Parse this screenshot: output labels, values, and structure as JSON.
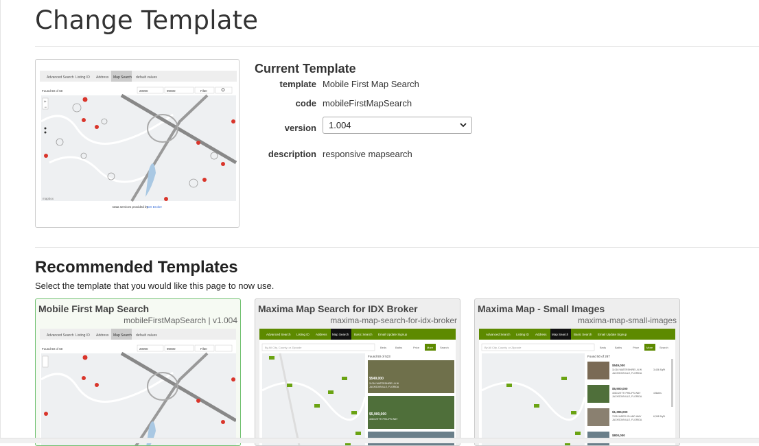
{
  "page": {
    "title": "Change Template"
  },
  "current": {
    "heading": "Current Template",
    "labels": {
      "template": "template",
      "code": "code",
      "version": "version",
      "description": "description"
    },
    "template": "Mobile First Map Search",
    "code": "mobileFirstMapSearch",
    "version": "1.004",
    "description": "responsive mapsearch",
    "thumb": {
      "tabs": [
        "Advanced Search",
        "Listing ID",
        "Address",
        "Map Search",
        "default values"
      ],
      "found": "Found 60 of 60",
      "min": "20000",
      "max": "90000",
      "filter": "Filter",
      "footer_prefix": "Data services provided by ",
      "footer_link": "IDX Broker"
    }
  },
  "recommended": {
    "heading": "Recommended Templates",
    "subtitle": "Select the template that you would like this page to now use.",
    "cards": [
      {
        "name": "Mobile First Map Search",
        "code": "mobileFirstMapSearch | v1.004",
        "selected": true
      },
      {
        "name": "Maxima Map Search for IDX Broker",
        "code": "maxima-map-search-for-idx-broker",
        "selected": false
      },
      {
        "name": "Maxima Map - Small Images",
        "code": "maxima-map-small-images",
        "selected": false
      }
    ]
  },
  "maxima_thumb": {
    "tabs": [
      "Advanced Search",
      "Listing ID",
      "Address",
      "Map Search",
      "Basic Search",
      "Email Update Signup"
    ],
    "search_placeholder": "By All City, County, or Zipcode",
    "filters": [
      "Beds",
      "Baths",
      "Price",
      "More",
      "Search"
    ],
    "found": "Found 50 of 523",
    "found_small": "Found 50 of 287",
    "listings": [
      {
        "price": "$549,000",
        "addr": "11016 WATERSHIRE LN W",
        "city": "JACKSONVILLE, FLORIDA",
        "meta": "3,436 SqFt"
      },
      {
        "price": "$5,900,000",
        "addr": "4063 ZETTI PHILIPS WAY",
        "city": "JACKSONVILLE, FLORIDA",
        "meta": "4 Baths"
      },
      {
        "price": "$1,395,000",
        "addr": "7035 JARED ISLAND WAY",
        "city": "JACKSONVILLE, FLORIDA",
        "meta": "6,398 SqFt"
      },
      {
        "price": "$800,000",
        "addr": "2 Sandpiper Rd",
        "city": "",
        "meta": ""
      }
    ]
  },
  "colors": {
    "accent": "#5d8a00",
    "selected_border": "#6dbf6d",
    "pin": "#d9352b"
  },
  "icons": [
    "chevron-down-icon",
    "filter-icon",
    "search-icon",
    "map-pin-icon"
  ]
}
